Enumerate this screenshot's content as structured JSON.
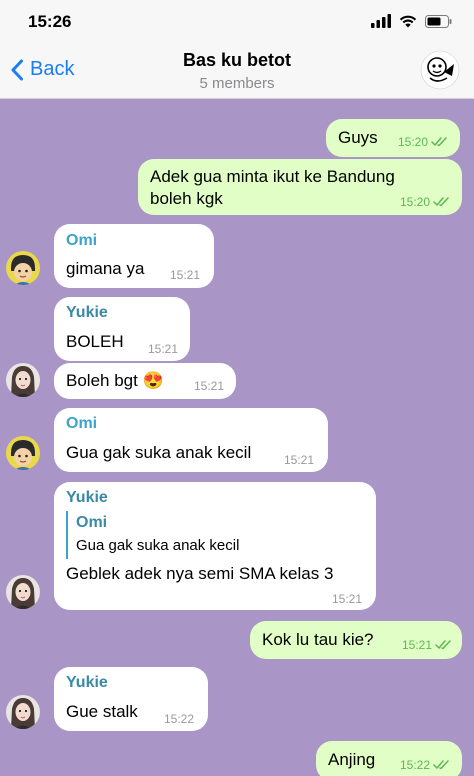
{
  "status": {
    "time": "15:26"
  },
  "nav": {
    "back_label": "Back",
    "title": "Bas ku betot",
    "subtitle": "5 members"
  },
  "colors": {
    "omi": "#3ea3c9",
    "yukie": "#3a8aa6",
    "outgoing_bubble": "#e1fec6",
    "incoming_bubble": "#ffffff",
    "chat_background": "#a996c7",
    "ios_blue": "#1a7df3",
    "read_check": "#5cb852"
  },
  "messages": [
    {
      "dir": "out",
      "text": "Guys",
      "time": "15:20"
    },
    {
      "dir": "out",
      "text": "Adek gua minta ikut ke Bandung\nboleh kgk",
      "time": "15:20"
    },
    {
      "dir": "in",
      "sender": "Omi",
      "text": "gimana ya",
      "time": "15:21"
    },
    {
      "dir": "in",
      "sender": "Yukie",
      "text": "BOLEH",
      "time": "15:21"
    },
    {
      "dir": "in",
      "text": "Boleh bgt 😍",
      "time": "15:21"
    },
    {
      "dir": "in",
      "sender": "Omi",
      "text": "Gua gak suka anak kecil",
      "time": "15:21"
    },
    {
      "dir": "in",
      "sender": "Yukie",
      "reply_to_name": "Omi",
      "reply_to_text": "Gua gak suka anak kecil",
      "text": "Geblek adek nya semi SMA kelas 3",
      "time": "15:21"
    },
    {
      "dir": "out",
      "text": "Kok lu tau kie?",
      "time": "15:21"
    },
    {
      "dir": "in",
      "sender": "Yukie",
      "text": "Gue stalk",
      "time": "15:22"
    },
    {
      "dir": "out",
      "text": "Anjing",
      "time": "15:22"
    }
  ]
}
